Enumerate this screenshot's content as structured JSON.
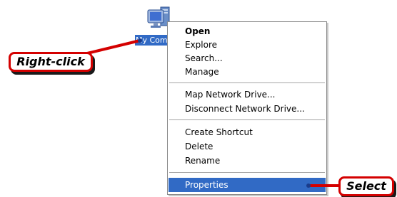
{
  "desktop": {
    "icon_label": "My Computer",
    "icon_name": "my-computer-icon"
  },
  "context_menu": {
    "groups": [
      {
        "items": [
          {
            "label": "Open",
            "bold": true
          },
          {
            "label": "Explore"
          },
          {
            "label": "Search..."
          },
          {
            "label": "Manage"
          }
        ]
      },
      {
        "items": [
          {
            "label": "Map Network Drive..."
          },
          {
            "label": "Disconnect Network Drive..."
          }
        ]
      },
      {
        "items": [
          {
            "label": "Create Shortcut"
          },
          {
            "label": "Delete"
          },
          {
            "label": "Rename"
          }
        ]
      },
      {
        "items": [
          {
            "label": "Properties",
            "highlighted": true
          }
        ]
      }
    ]
  },
  "callouts": {
    "right_click": "Right-click",
    "select": "Select"
  },
  "colors": {
    "selection": "#316ac5",
    "callout_border": "#d40000",
    "pointer_line": "#d40000",
    "pointer_end": "#1a3c8c"
  }
}
